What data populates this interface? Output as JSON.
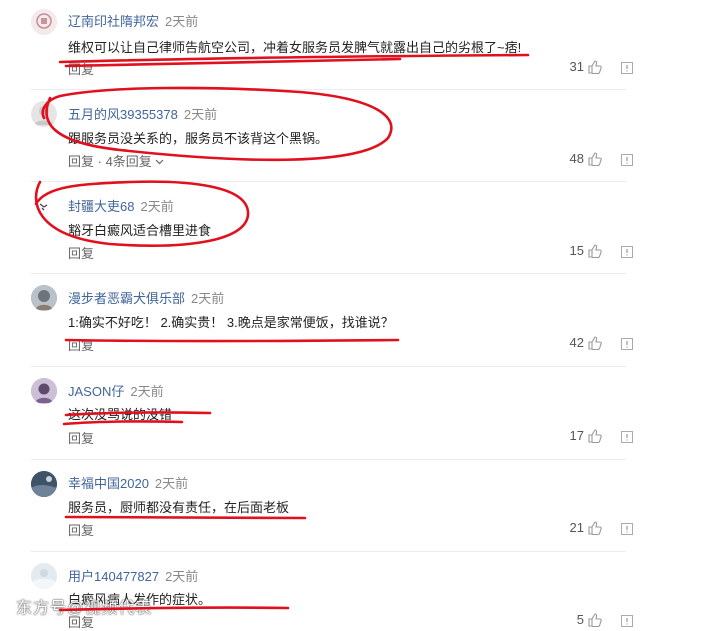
{
  "comments": [
    {
      "username": "辽南印社隋邦宏",
      "time": "2天前",
      "text": "维权可以让自己律师告航空公司，冲着女服务员发脾气就露出自己的劣根了~痞!",
      "reply_label": "回复",
      "reply_extra": "",
      "likes": "31"
    },
    {
      "username": "五月的风39355378",
      "time": "2天前",
      "text": "跟服务员没关系的，服务员不该背这个黑锅。",
      "reply_label": "回复",
      "reply_extra": " · 4条回复",
      "likes": "48"
    },
    {
      "username": "封疆大吏68",
      "time": "2天前",
      "text": "豁牙白癜风适合槽里进食",
      "reply_label": "回复",
      "reply_extra": "",
      "likes": "15"
    },
    {
      "username": "漫步者恶霸犬俱乐部",
      "time": "2天前",
      "text": "1:确实不好吃！ 2.确实贵！ 3.晚点是家常便饭，找谁说？",
      "reply_label": "回复",
      "reply_extra": "",
      "likes": "42"
    },
    {
      "username": "JASON仔",
      "time": "2天前",
      "text": "这次没骂说的没错",
      "reply_label": "回复",
      "reply_extra": "",
      "likes": "17"
    },
    {
      "username": "幸福中国2020",
      "time": "2天前",
      "text": "服务员，厨师都没有责任，在后面老板",
      "reply_label": "回复",
      "reply_extra": "",
      "likes": "21"
    },
    {
      "username": "用户140477827",
      "time": "2天前",
      "text": "白癜风病人发作的症状。",
      "reply_label": "回复",
      "reply_extra": "",
      "likes": "5"
    }
  ],
  "watermark": "东方号@视频代表",
  "icons": {
    "like": "thumbs-up-icon",
    "report": "report-icon",
    "expand": "chevron-down-icon"
  },
  "colors": {
    "username": "#406599",
    "annotation": "#e0101e",
    "text": "#222222",
    "muted": "#888888"
  }
}
